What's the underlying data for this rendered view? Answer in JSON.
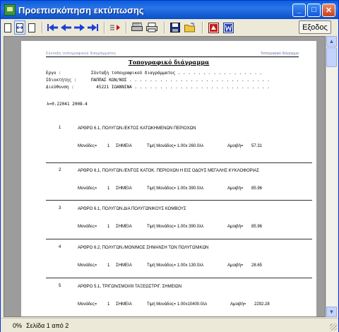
{
  "window": {
    "title": "Προεπισκόπηση εκτύπωσης"
  },
  "toolbar": {
    "exit_label": "Εξοδος"
  },
  "report": {
    "header_left": "Σύνταξη τοπογραφικού διαγράμματος",
    "header_right": "Τοπογραφικό διάγραμμα",
    "title": "Τοπογραφικό διάγραμμα",
    "meta": [
      {
        "label": "Εργο :",
        "value": "Σύνταξη τοπογραφικού διαγράμματος . . . . . . . . . . . . . . . . ."
      },
      {
        "label": "Ιδιοκτήτης :",
        "value": "ΠΑΠΠΑΣ ΚΩΝ/ΝΟΣ . . . . . . . . . . . . . . . . . . . . . . . . . . . ."
      },
      {
        "label": "Διεύθυνση :",
        "value": "  45221 ΙΩΑΝΝΙΝΑ . . . . . . . . . . . . . . . . . . . . . . . . . . ."
      }
    ],
    "lambda": "λ=0.22041 2008-4",
    "items": [
      {
        "num": "1",
        "desc": "ΑΡΘΡΟ 6.1, ΠΟΛΥΓΩΝ./ΕΚΤΟΣ ΚΑΤΩΚΗΜΕΝΩΝ ΠΕΡΙΟΧΩΝ",
        "monades": "Μονάδες=",
        "qty": "1",
        "unit": "ΣΗΜΕΙΑ",
        "price": "Τιμή Μονάδος= 1.00x 260.0λλ",
        "amoivi_label": "Αμοιβή=",
        "amoivi": "57.31"
      },
      {
        "num": "2",
        "desc": "ΑΡΘΡΟ 6.1, ΠΟΛΥΓΩΝ./ΕΝΤΟΣ ΚΑΤΟΚ. ΠΕΡΙΟΧΩΝ Η ΕΙΣ ΟΔΟΥΣ ΜΕΓΑΛΗΣ ΚΥΚΛΟΦΟΡΙΑΣ",
        "monades": "Μονάδες=",
        "qty": "1",
        "unit": "ΣΗΜΕΙΑ",
        "price": "Τιμή Μονάδος= 1.00x 390.0λλ",
        "amoivi_label": "Αμοιβή=",
        "amoivi": "85.96"
      },
      {
        "num": "3",
        "desc": "ΑΡΘΡΟ 6.1, ΠΟΛΥΓΩΝ.ΔΙΑ ΠΟΛΥΓΩΝΙΚΟΥΣ ΚΟΜΒΟΥΣ",
        "monades": "Μονάδες=",
        "qty": "1",
        "unit": "ΣΗΜΕΙΑ",
        "price": "Τιμή Μονάδος= 1.00x 390.0λλ",
        "amoivi_label": "Αμοιβή=",
        "amoivi": "85.96"
      },
      {
        "num": "4",
        "desc": "ΑΡΘΡΟ 6.2, ΠΟΛΥΓΩΝ./ΜΟΝΙΜΟΣ ΣΗΜΑΝΣΗ ΤΩΝ ΠΟΛΥΓΩΝΙΚΩΝ",
        "monades": "Μονάδες=",
        "qty": "1",
        "unit": "ΣΗΜΕΙΑ",
        "price": "Τιμή Μονάδος= 1.00x 130.0λλ",
        "amoivi_label": "Αμοιβή=",
        "amoivi": "28.65"
      },
      {
        "num": "5",
        "desc": "ΑΡΘΡΟ 5.1, ΤΡΙΓΩΝ/ΣΜΟΙ/ΙΙΙ ΤΑΞΕΩΣΤΡΙΓ. ΣΗΜΕΙΩΝ",
        "monades": "Μονάδες=",
        "qty": "1",
        "unit": "ΣΗΜΕΙΑ",
        "price": "Τιμή Μονάδος= 1.00x10400.0λλ",
        "amoivi_label": "Αμοιβή=",
        "amoivi": "2292.28"
      }
    ]
  },
  "status": {
    "percent": "0%",
    "page": "Σελίδα 1 από 2"
  }
}
